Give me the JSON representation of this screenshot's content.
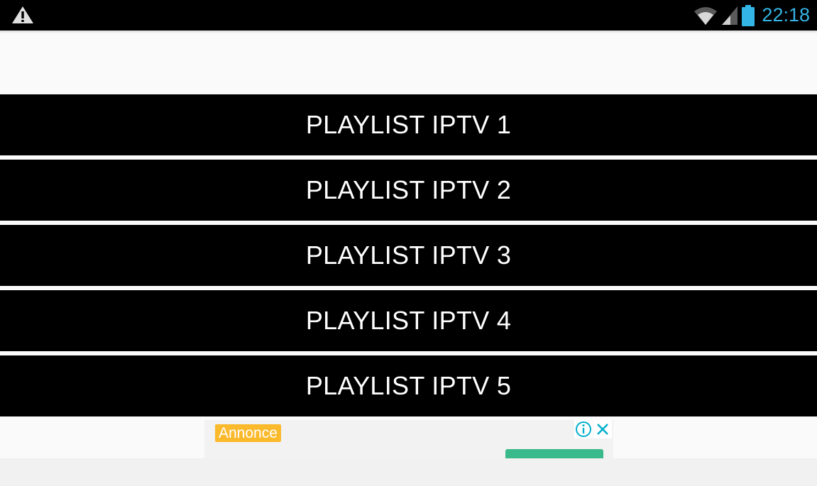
{
  "status_bar": {
    "time": "22:18",
    "time_color": "#33b5e5",
    "icons": [
      "warning-icon",
      "wifi-icon",
      "signal-icon",
      "battery-icon"
    ]
  },
  "playlists": [
    {
      "label": "PLAYLIST IPTV 1"
    },
    {
      "label": "PLAYLIST IPTV 2"
    },
    {
      "label": "PLAYLIST IPTV 3"
    },
    {
      "label": "PLAYLIST IPTV 4"
    },
    {
      "label": "PLAYLIST IPTV 5"
    }
  ],
  "ad": {
    "badge": "Annonce",
    "badge_color": "#fbb92c",
    "cta_color": "#3ab98a",
    "icons": [
      "info-icon",
      "close-icon"
    ]
  },
  "colors": {
    "button_bg": "#000000",
    "button_text": "#ffffff",
    "page_bg": "#fafafa"
  }
}
